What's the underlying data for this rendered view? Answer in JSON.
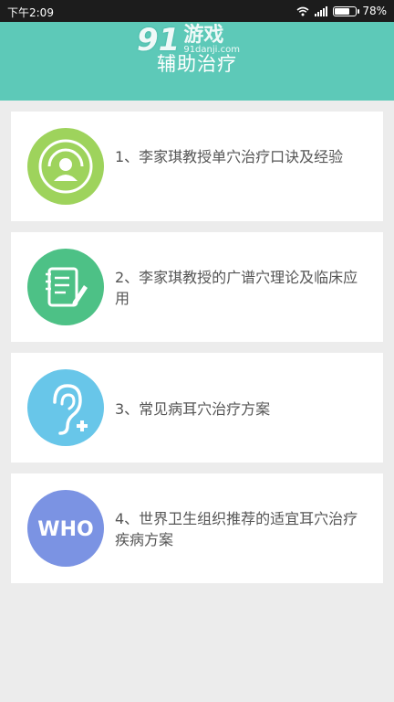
{
  "status_bar": {
    "time": "下午2:09",
    "battery": "78%",
    "battery_level": 0.78
  },
  "watermark": {
    "number": "91",
    "brand_cn": "游戏",
    "brand_url": "91danji.com"
  },
  "header": {
    "title": "辅助治疗",
    "color": "#5dc9b8"
  },
  "items": [
    {
      "label": "1、李家琪教授单穴治疗口诀及经验",
      "icon": "person-radar-icon",
      "color": "#9ed35c"
    },
    {
      "label": "2、李家琪教授的广谱穴理论及临床应用",
      "icon": "document-edit-icon",
      "color": "#4dc186"
    },
    {
      "label": "3、常见病耳穴治疗方案",
      "icon": "ear-plus-icon",
      "color": "#68c6e9"
    },
    {
      "label": "4、世界卫生组织推荐的适宜耳穴治疗疾病方案",
      "icon": "who-icon",
      "icon_text": "WHO",
      "color": "#7b93e3"
    }
  ]
}
